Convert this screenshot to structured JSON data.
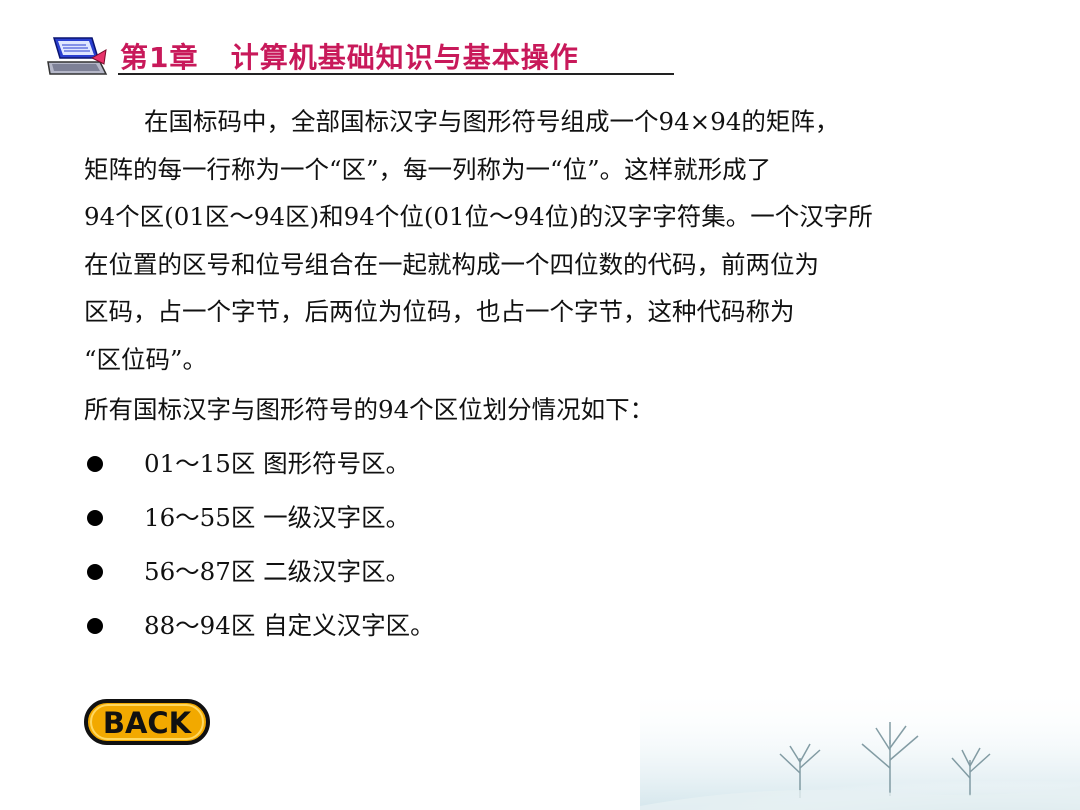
{
  "header": {
    "title": "第1章   计算机基础知识与基本操作",
    "icon": "computer-icon"
  },
  "paragraph": {
    "lines": [
      "在国标码中，全部国标汉字与图形符号组成一个94×94的矩阵，",
      "矩阵的每一行称为一个“区”，每一列称为一“位”。这样就形成了",
      "94个区(01区～94区)和94个位(01位～94位)的汉字字符集。一个汉字所",
      "在位置的区号和位号组合在一起就构成一个四位数的代码，前两位为",
      "区码，占一个字节，后两位为位码，也占一个字节，这种代码称为",
      "“区位码”。"
    ]
  },
  "intro": "所有国标汉字与图形符号的94个区位划分情况如下：",
  "bullets": [
    "01～15区 图形符号区。",
    "16～55区 一级汉字区。",
    "56～87区 二级汉字区。",
    "88～94区 自定义汉字区。"
  ],
  "back_button": {
    "label": "BACK"
  },
  "colors": {
    "title": "#c8195a",
    "back_fill": "#f2a900",
    "back_border": "#111111"
  }
}
